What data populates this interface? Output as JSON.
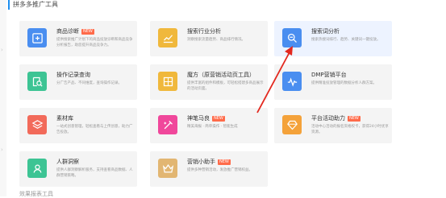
{
  "section": {
    "title": "拼多多推广工具"
  },
  "cards": [
    {
      "title": "商品诊断",
      "badge": "NEW",
      "desc": "提供搜索推广计划下的商品投放诊断和商品竞争分析报告，助您提升商品竞争力。",
      "color": "#4a8ef0",
      "icon": "diagnosis-icon"
    },
    {
      "title": "搜索行业分析",
      "badge": "",
      "desc": "洞察搜索流量趋势、商品排行情况。",
      "color": "#f0b83c",
      "icon": "trend-chart-icon"
    },
    {
      "title": "搜索词分析",
      "badge": "",
      "desc": "搜索热搜词排行、趋势、关键词一键投放。",
      "color": "#4a8ef0",
      "icon": "search-analysis-icon"
    },
    {
      "title": "操作记录查询",
      "badge": "",
      "desc": "分广告产品、不同维度，查询操作记录。",
      "color": "#3dc494",
      "icon": "record-search-icon"
    },
    {
      "title": "魔方（原营销活动页工具）",
      "badge": "",
      "desc": "提供丰富的组件和模板，可轻松搭建多商品展示的活动页面。",
      "color": "#f0b83c",
      "icon": "rubik-cube-icon"
    },
    {
      "title": "DMP营销平台",
      "badge": "",
      "desc": "提供精准投放管理的数据分析人群方案。",
      "color": "#4a8ef0",
      "icon": "pulse-chart-icon"
    },
    {
      "title": "素材库",
      "badge": "",
      "desc": "一站式创意管理，轻松查看与上传创意，助力广告投放。",
      "color": "#f26a5a",
      "icon": "layers-icon"
    },
    {
      "title": "神笔马良",
      "badge": "NEW",
      "desc": "精美海报 · 简单操作 · 智能生成",
      "color": "#f0479b",
      "icon": "magic-brush-icon"
    },
    {
      "title": "平台活动助力",
      "badge": "NEW",
      "desc": "活动中心活动的报名资格权卡，获得24小时优享资源。",
      "color": "#f4a23a",
      "icon": "diamond-icon"
    },
    {
      "title": "人群洞察",
      "badge": "",
      "desc": "提供人群洞察解析服务，支持查看商品数据、人群营销策略。",
      "color": "#3dc494",
      "icon": "person-insight-icon"
    },
    {
      "title": "营销小助手",
      "badge": "NEW",
      "desc": "提供多种营销活动，发放推广营销权益。",
      "color": "#e2b672",
      "icon": "crown-icon"
    }
  ],
  "footer": {
    "text": "效果报表工具"
  }
}
